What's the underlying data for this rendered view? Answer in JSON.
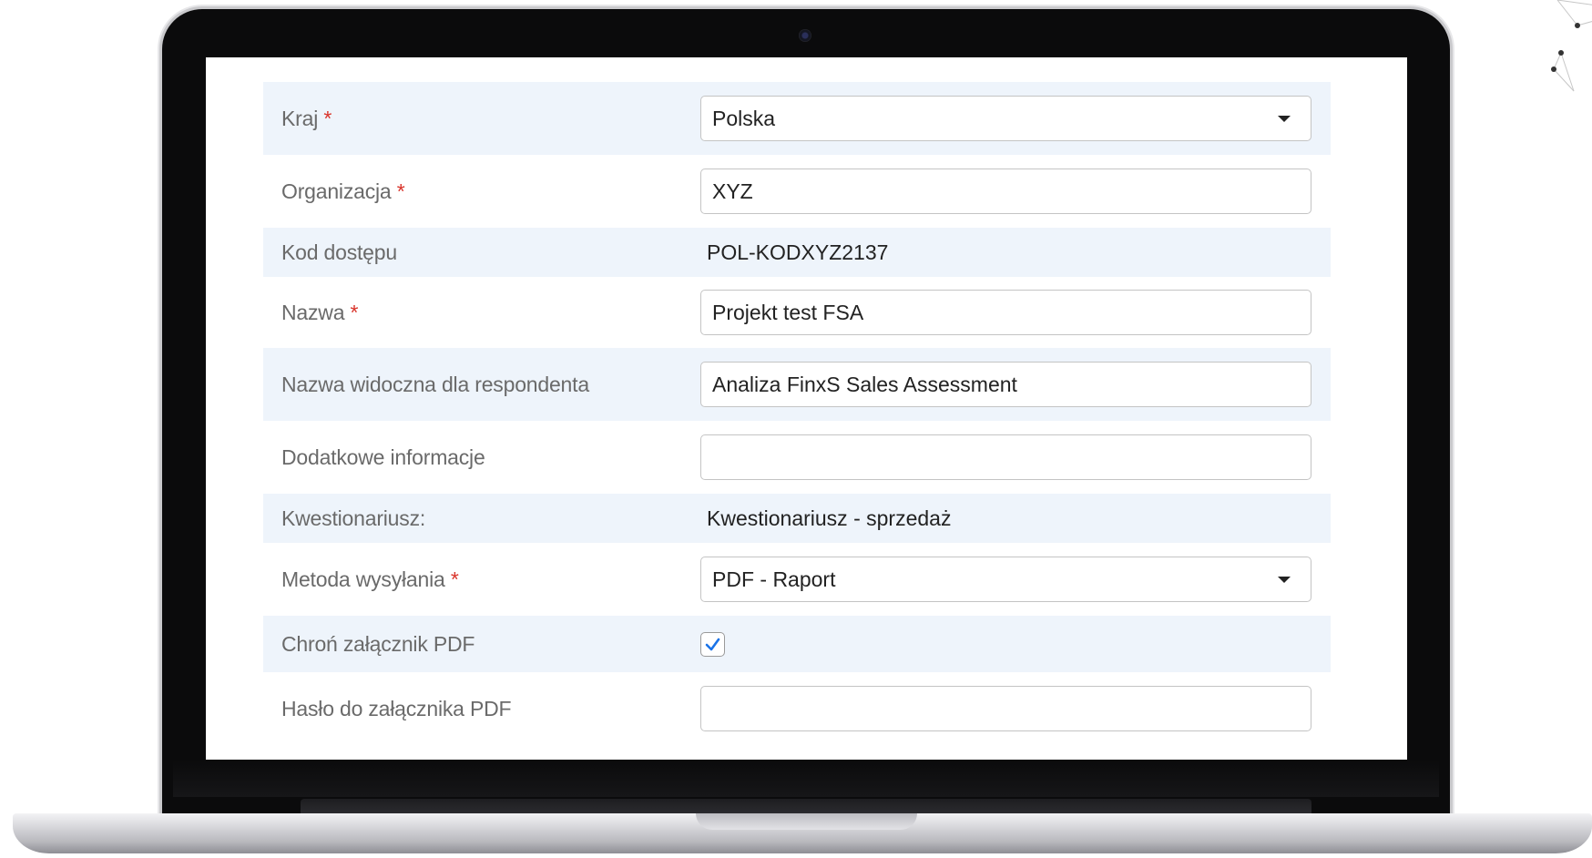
{
  "form": {
    "country": {
      "label": "Kraj",
      "required_mark": "*",
      "value": "Polska"
    },
    "organization": {
      "label": "Organizacja",
      "required_mark": "*",
      "value": "XYZ"
    },
    "access_code": {
      "label": "Kod dostępu",
      "value": "POL-KODXYZ2137"
    },
    "name": {
      "label": "Nazwa",
      "required_mark": "*",
      "value": "Projekt test FSA"
    },
    "respondent_name": {
      "label": "Nazwa widoczna dla respondenta",
      "value": "Analiza FinxS Sales Assessment"
    },
    "additional_info": {
      "label": "Dodatkowe informacje",
      "value": ""
    },
    "questionnaire": {
      "label": "Kwestionariusz:",
      "value": "Kwestionariusz - sprzedaż"
    },
    "send_method": {
      "label": "Metoda wysyłania",
      "required_mark": "*",
      "value": "PDF - Raport"
    },
    "protect_pdf": {
      "label": "Chroń załącznik PDF",
      "checked": true
    },
    "pdf_password": {
      "label": "Hasło do załącznika PDF",
      "value": ""
    }
  },
  "colors": {
    "row_alt_bg": "#eef4fb",
    "required": "#d9342b",
    "checkbox_check": "#1a73e8",
    "label_text": "#6a6a6a"
  },
  "icons": {
    "dropdown": "chevron-down-icon",
    "checkbox": "check-icon"
  }
}
